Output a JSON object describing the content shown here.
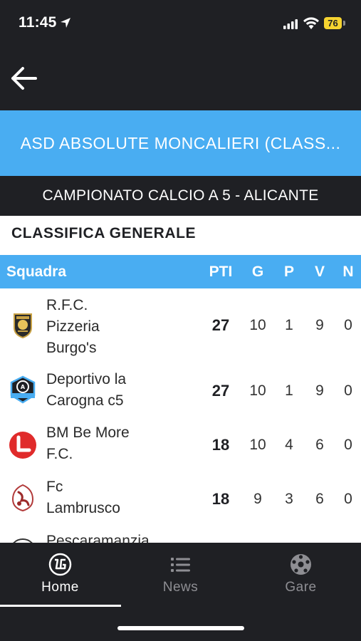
{
  "status_bar": {
    "time": "11:45",
    "battery": "76",
    "icons": [
      "location-arrow-icon",
      "cellular-signal-icon",
      "wifi-icon",
      "battery-icon"
    ]
  },
  "header": {
    "back_icon": "back-arrow-icon",
    "title": "ASD ABSOLUTE MONCALIERI (CLASS...",
    "championship": "CAMPIONATO CALCIO A 5 - ALICANTE"
  },
  "section_title": "CLASSIFICA GENERALE",
  "table": {
    "columns": {
      "team": "Squadra",
      "pti": "PTI",
      "g": "G",
      "p": "P",
      "v": "V",
      "n": "N"
    },
    "rows": [
      {
        "team_lines": [
          "R.F.C.",
          "Pizzeria",
          "Burgo's"
        ],
        "pti": "27",
        "g": "10",
        "p": "1",
        "v": "9",
        "n": "0",
        "logo": "rfc-pizzeria-burgos-logo"
      },
      {
        "team_lines": [
          "Deportivo la",
          "Carogna c5"
        ],
        "pti": "27",
        "g": "10",
        "p": "1",
        "v": "9",
        "n": "0",
        "logo": "deportivo-la-carogna-logo"
      },
      {
        "team_lines": [
          "BM Be More",
          "F.C."
        ],
        "pti": "18",
        "g": "10",
        "p": "4",
        "v": "6",
        "n": "0",
        "logo": "bm-be-more-logo"
      },
      {
        "team_lines": [
          "Fc",
          "Lambrusco"
        ],
        "pti": "18",
        "g": "9",
        "p": "3",
        "v": "6",
        "n": "0",
        "logo": "fc-lambrusco-logo"
      },
      {
        "team_lines": [
          "Pescaramanzia"
        ],
        "logo": "pescaramanzia-logo"
      }
    ]
  },
  "bottom_nav": {
    "items": [
      {
        "label": "Home",
        "icon": "app-logo-icon",
        "active": true
      },
      {
        "label": "News",
        "icon": "list-icon",
        "active": false
      },
      {
        "label": "Gare",
        "icon": "soccer-ball-icon",
        "active": false
      }
    ]
  },
  "colors": {
    "dark": "#1f2024",
    "accent_blue": "#49adf2",
    "battery_yellow": "#f5d330",
    "inactive_nav": "#8e8e93"
  }
}
